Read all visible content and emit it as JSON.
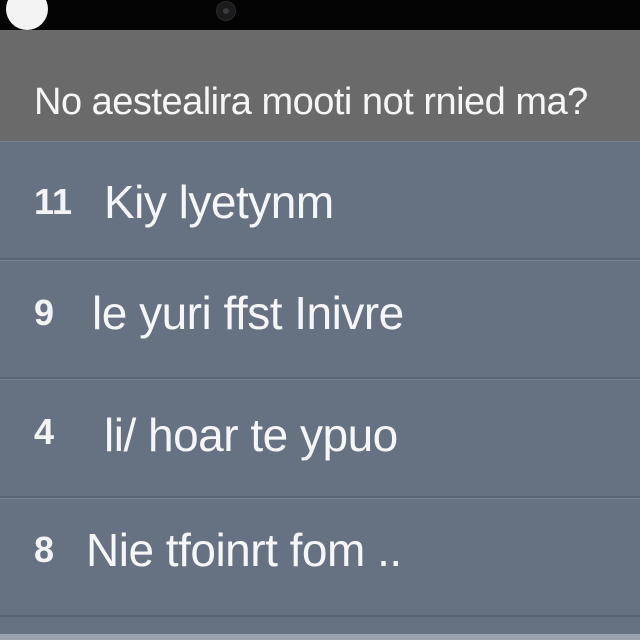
{
  "header": {
    "title": "No aestealira mooti not rnied ma?"
  },
  "list": {
    "items": [
      {
        "number": "11",
        "label": "Kiy lyetynm"
      },
      {
        "number": "9",
        "label": "le yuri ffst Inivre"
      },
      {
        "number": "4",
        "label": "li/ hoar te ypuo"
      },
      {
        "number": "8",
        "label": "Nie tfoinrt fom .."
      }
    ]
  },
  "icons": {
    "status": "status-dot-icon",
    "camera": "camera-icon"
  },
  "colors": {
    "top_bar": "#040405",
    "header_bg": "#6b6a6b",
    "list_bg": "#667282",
    "text": "#f5f6f8"
  }
}
